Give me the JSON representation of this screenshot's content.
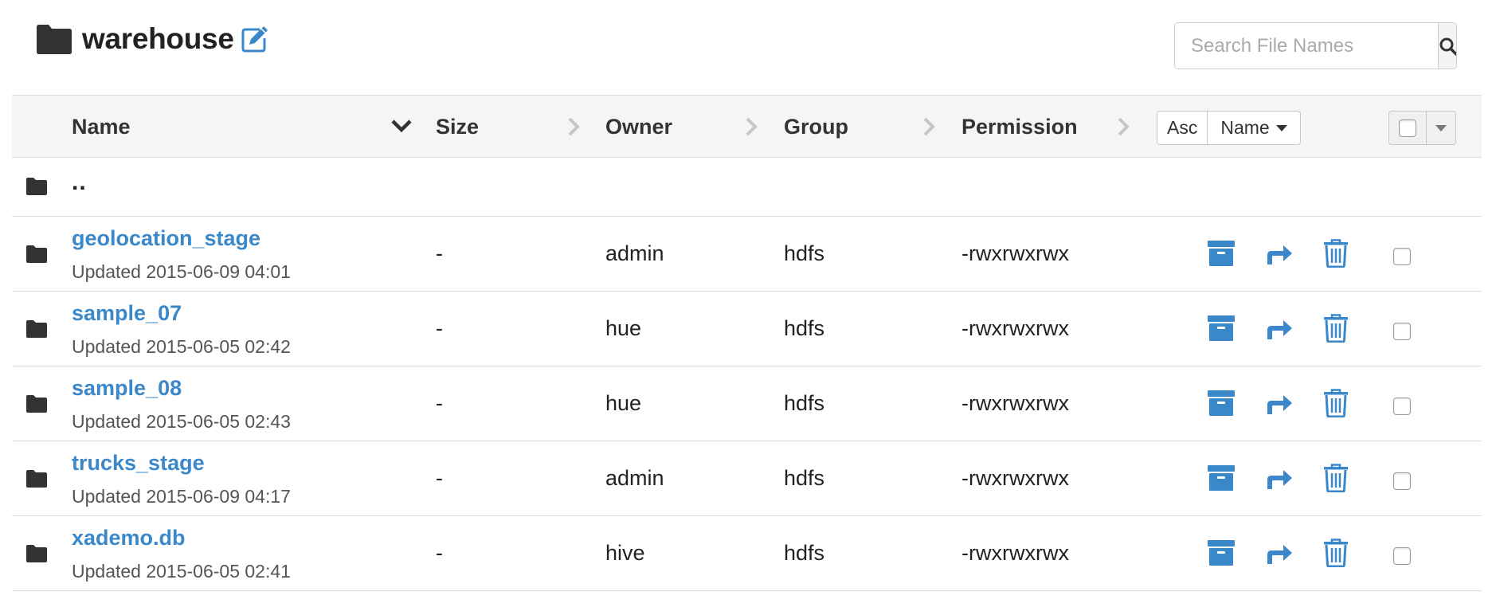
{
  "header": {
    "title": "warehouse",
    "search_placeholder": "Search File Names"
  },
  "table": {
    "columns": [
      "Name",
      "Size",
      "Owner",
      "Group",
      "Permission"
    ],
    "sort": {
      "order": "Asc",
      "field": "Name"
    },
    "parent_label": "..",
    "rows": [
      {
        "name": "geolocation_stage",
        "updated": "Updated 2015-06-09 04:01",
        "size": "-",
        "owner": "admin",
        "group": "hdfs",
        "permission": "-rwxrwxrwx"
      },
      {
        "name": "sample_07",
        "updated": "Updated 2015-06-05 02:42",
        "size": "-",
        "owner": "hue",
        "group": "hdfs",
        "permission": "-rwxrwxrwx"
      },
      {
        "name": "sample_08",
        "updated": "Updated 2015-06-05 02:43",
        "size": "-",
        "owner": "hue",
        "group": "hdfs",
        "permission": "-rwxrwxrwx"
      },
      {
        "name": "trucks_stage",
        "updated": "Updated 2015-06-09 04:17",
        "size": "-",
        "owner": "admin",
        "group": "hdfs",
        "permission": "-rwxrwxrwx"
      },
      {
        "name": "xademo.db",
        "updated": "Updated 2015-06-05 02:41",
        "size": "-",
        "owner": "hive",
        "group": "hdfs",
        "permission": "-rwxrwxrwx"
      }
    ]
  },
  "colors": {
    "link": "#3a87c9",
    "action_icon": "#3a87c9",
    "folder_icon": "#333333",
    "header_bg": "#f5f5f5"
  },
  "icons": {
    "title": "folder-icon",
    "edit": "edit-icon",
    "search": "search-icon",
    "row_actions": [
      "archive-icon",
      "move-icon",
      "trash-icon"
    ]
  }
}
